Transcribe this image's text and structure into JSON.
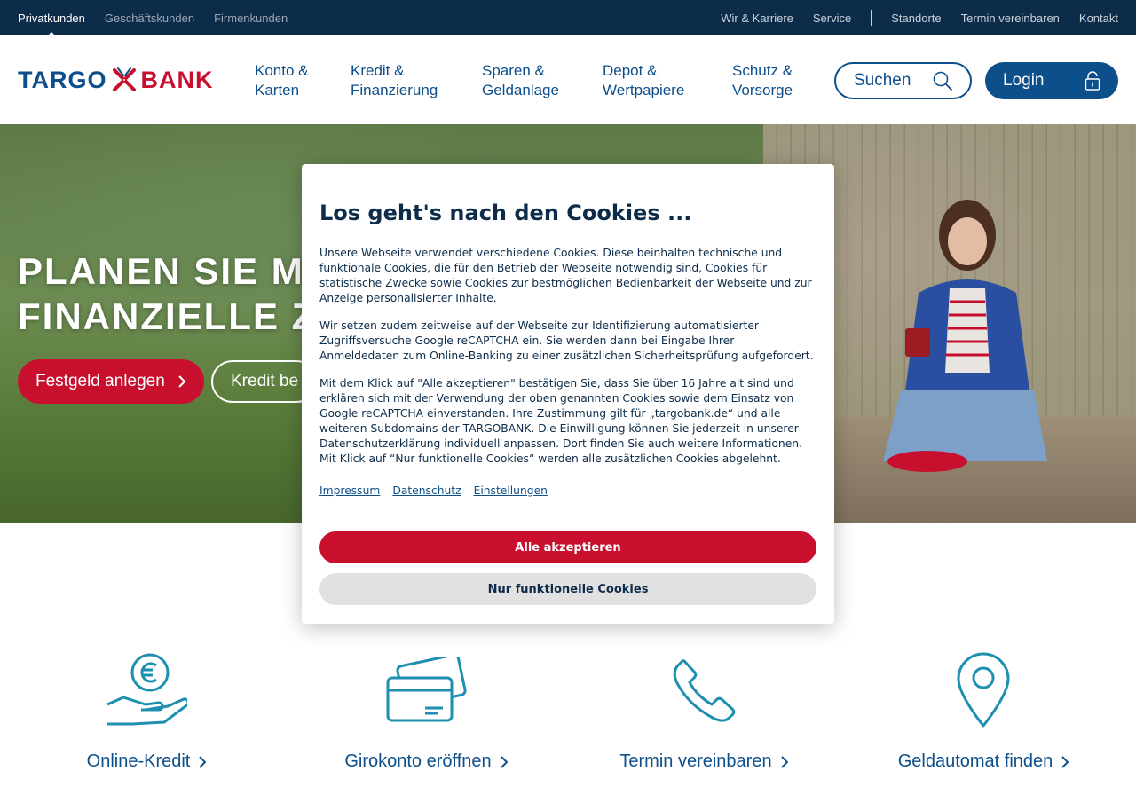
{
  "topbar": {
    "segments": [
      "Privatkunden",
      "Geschäftskunden",
      "Firmenkunden"
    ],
    "links": [
      "Wir & Karriere",
      "Service",
      "Standorte",
      "Termin vereinbaren",
      "Kontakt"
    ]
  },
  "logo": {
    "part1": "TARGO",
    "part2": "BANK"
  },
  "nav": [
    "Konto &\nKarten",
    "Kredit &\nFinanzierung",
    "Sparen &\nGeldanlage",
    "Depot &\nWertpapiere",
    "Schutz &\nVorsorge"
  ],
  "search": {
    "label": "Suchen",
    "icon": "search-icon"
  },
  "login": {
    "label": "Login",
    "icon": "lock-icon"
  },
  "hero": {
    "headline": "PLANEN SIE MIT\nFINANZIELLE ZU",
    "primary_button": "Festgeld anlegen",
    "secondary_button": "Kredit be"
  },
  "cookie": {
    "title": "Los geht's nach den Cookies ...",
    "p1": "Unsere Webseite verwendet verschiedene Cookies. Diese beinhalten technische und funktionale Cookies, die für den Betrieb der Webseite notwendig sind, Cookies für statistische Zwecke sowie Cookies zur bestmöglichen Bedienbarkeit der Webseite und zur Anzeige personalisierter Inhalte.",
    "p2": "Wir setzen zudem zeitweise auf der Webseite zur Identifizierung automatisierter Zugriffsversuche Google reCAPTCHA ein. Sie werden dann bei Eingabe Ihrer Anmeldedaten zum Online-Banking zu einer zusätzlichen Sicherheitsprüfung aufgefordert.",
    "p3": "Mit dem Klick auf \"Alle akzeptieren\" bestätigen Sie, dass Sie über 16 Jahre alt sind und erklären sich mit der Verwendung der oben genannten Cookies sowie dem Einsatz von Google reCAPTCHA einverstanden. Ihre Zustimmung gilt für „targobank.de“ und alle weiteren Subdomains der TARGOBANK. Die Einwilligung können Sie jederzeit in unserer Datenschutzerklärung individuell anpassen. Dort finden Sie auch weitere Informationen. Mit Klick auf “Nur funktionelle Cookies“ werden alle zusätzlichen Cookies abgelehnt.",
    "links": [
      "Impressum",
      "Datenschutz",
      "Einstellungen"
    ],
    "accept": "Alle akzeptieren",
    "functional": "Nur funktionelle Cookies"
  },
  "tiles": [
    {
      "label": "Online-Kredit",
      "icon": "euro-hand-icon"
    },
    {
      "label": "Girokonto eröffnen",
      "icon": "credit-card-icon"
    },
    {
      "label": "Termin vereinbaren",
      "icon": "phone-icon"
    },
    {
      "label": "Geldautomat finden",
      "icon": "location-pin-icon"
    }
  ],
  "colors": {
    "navy": "#0d2c4a",
    "blue": "#0d4f8a",
    "red": "#c8102e",
    "teal": "#1f8fb0"
  }
}
